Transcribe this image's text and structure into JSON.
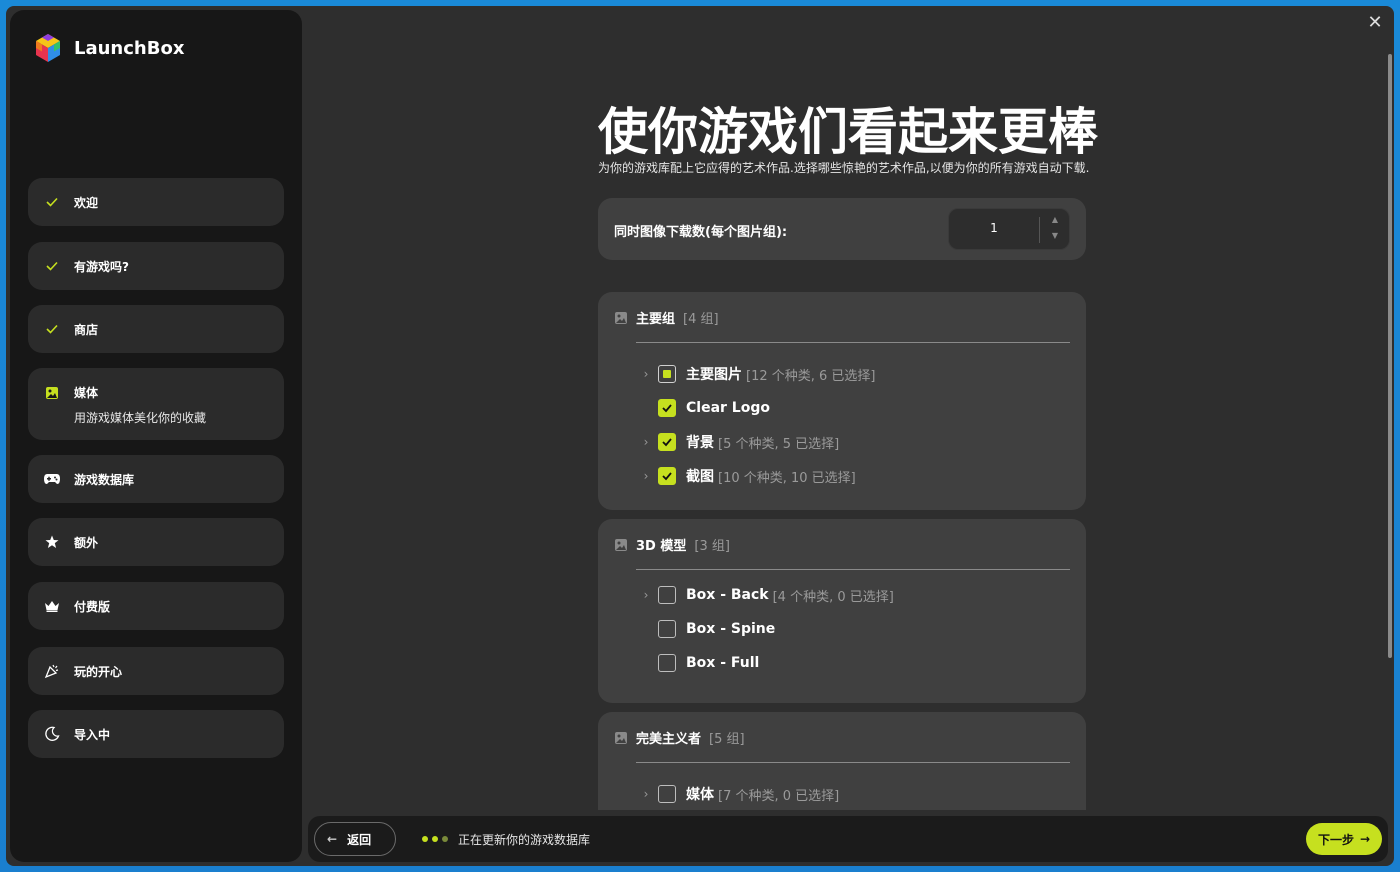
{
  "app": {
    "name": "LaunchBox"
  },
  "sidebar": {
    "items": [
      {
        "label": "欢迎",
        "icon": "check-icon",
        "status": "done"
      },
      {
        "label": "有游戏吗?",
        "icon": "check-icon",
        "status": "done"
      },
      {
        "label": "商店",
        "icon": "check-icon",
        "status": "done"
      },
      {
        "label": "媒体",
        "icon": "image-icon",
        "status": "active",
        "sub": "用游戏媒体美化你的收藏"
      },
      {
        "label": "游戏数据库",
        "icon": "gamepad-icon",
        "status": "pending"
      },
      {
        "label": "额外",
        "icon": "star-icon",
        "status": "pending"
      },
      {
        "label": "付费版",
        "icon": "crown-icon",
        "status": "pending"
      },
      {
        "label": "玩的开心",
        "icon": "party-popper-icon",
        "status": "pending"
      },
      {
        "label": "导入中",
        "icon": "moon-icon",
        "status": "pending"
      }
    ]
  },
  "main": {
    "title": "使你游戏们看起来更棒",
    "subtitle": "为你的游戏库配上它应得的艺术作品.选择哪些惊艳的艺术作品,以便为你的所有游戏自动下载.",
    "downloads": {
      "label": "同时图像下载数(每个图片组):",
      "value": "1"
    },
    "groups": [
      {
        "title": "主要组",
        "count": "[4 组]",
        "options": [
          {
            "name": "主要图片",
            "meta": "[12 个种类, 6 已选择]",
            "state": "partial",
            "expandable": true
          },
          {
            "name": "Clear Logo",
            "meta": "",
            "state": "checked",
            "expandable": false
          },
          {
            "name": "背景",
            "meta": "[5 个种类, 5 已选择]",
            "state": "checked",
            "expandable": true
          },
          {
            "name": "截图",
            "meta": "[10 个种类, 10 已选择]",
            "state": "checked",
            "expandable": true
          }
        ]
      },
      {
        "title": "3D 模型",
        "count": "[3 组]",
        "options": [
          {
            "name": "Box - Back",
            "meta": "[4 个种类, 0 已选择]",
            "state": "unchecked",
            "expandable": true
          },
          {
            "name": "Box - Spine",
            "meta": "",
            "state": "unchecked",
            "expandable": false
          },
          {
            "name": "Box - Full",
            "meta": "",
            "state": "unchecked",
            "expandable": false
          }
        ]
      },
      {
        "title": "完美主义者",
        "count": "[5 组]",
        "options": [
          {
            "name": "媒体",
            "meta": "[7 个种类, 0 已选择]",
            "state": "unchecked",
            "expandable": true
          }
        ]
      }
    ]
  },
  "footer": {
    "back_label": "返回",
    "status": "正在更新你的游戏数据库",
    "next_label": "下一步"
  },
  "colors": {
    "accent": "#c6e01f",
    "panel": "#404040",
    "sidebar": "#171717",
    "background": "#2e2e2e"
  }
}
